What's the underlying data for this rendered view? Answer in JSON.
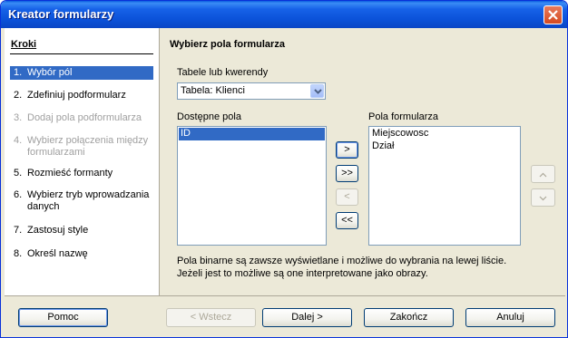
{
  "window": {
    "title": "Kreator formularzy"
  },
  "sidebar": {
    "title": "Kroki",
    "steps": [
      {
        "num": "1.",
        "label": "Wybór pól",
        "state": "active"
      },
      {
        "num": "2.",
        "label": "Zdefiniuj podformularz",
        "state": "normal"
      },
      {
        "num": "3.",
        "label": "Dodaj pola podformularza",
        "state": "disabled"
      },
      {
        "num": "4.",
        "label": "Wybierz połączenia między formularzami",
        "state": "disabled"
      },
      {
        "num": "5.",
        "label": "Rozmieść formanty",
        "state": "normal"
      },
      {
        "num": "6.",
        "label": "Wybierz tryb wprowadzania danych",
        "state": "normal"
      },
      {
        "num": "7.",
        "label": "Zastosuj style",
        "state": "normal"
      },
      {
        "num": "8.",
        "label": "Określ nazwę",
        "state": "normal"
      }
    ]
  },
  "main": {
    "title": "Wybierz pola formularza",
    "tables_label": "Tabele lub kwerendy",
    "tables_value": "Tabela: Klienci",
    "available_label": "Dostępne pola",
    "available_items": [
      "ID"
    ],
    "form_fields_label": "Pola formularza",
    "form_fields_items": [
      "Miejscowosc",
      "Dział"
    ],
    "move_right": ">",
    "move_all_right": ">>",
    "move_left": "<",
    "move_all_left": "<<",
    "move_up": "^",
    "move_down": "v",
    "info_line1": "Pola binarne są zawsze wyświetlane i możliwe do wybrania na lewej liście.",
    "info_line2": "Jeżeli jest to możliwe są one interpretowane jako obrazy."
  },
  "footer": {
    "help": "Pomoc",
    "back": "< Wstecz",
    "next": "Dalej >",
    "finish": "Zakończ",
    "cancel": "Anuluj"
  },
  "colors": {
    "titlebar": "#0b51d8",
    "selection": "#316ac5",
    "dialog": "#ece9d8"
  }
}
